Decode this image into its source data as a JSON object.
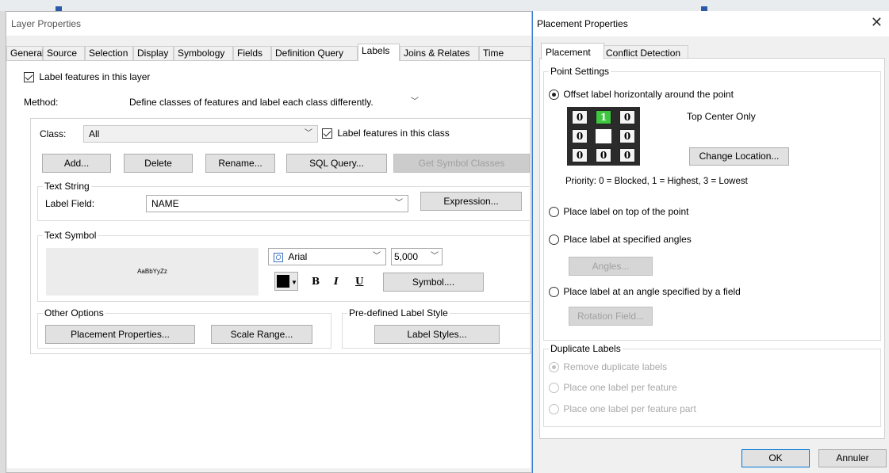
{
  "layer_props": {
    "title": "Layer Properties",
    "tabs": [
      "General",
      "Source",
      "Selection",
      "Display",
      "Symbology",
      "Fields",
      "Definition Query",
      "Labels",
      "Joins & Relates",
      "Time"
    ],
    "label_features_layer": "Label features in this layer",
    "method_label": "Method:",
    "method_value": "Define classes of features and label each class differently.",
    "class_label": "Class:",
    "class_value": "All",
    "label_features_class": "Label features in this class",
    "buttons": {
      "add": "Add...",
      "delete": "Delete",
      "rename": "Rename...",
      "sql_query": "SQL Query...",
      "get_symbol_classes": "Get Symbol Classes"
    },
    "text_string": {
      "legend": "Text String",
      "label_field_label": "Label Field:",
      "label_field_value": "NAME",
      "expression": "Expression..."
    },
    "text_symbol": {
      "legend": "Text Symbol",
      "preview": "AaBbYyZz",
      "font": "Arial",
      "size": "5,000",
      "bold": "B",
      "italic": "I",
      "underline": "U",
      "symbol": "Symbol....",
      "color": "#000000"
    },
    "other_options": {
      "legend": "Other Options",
      "placement": "Placement Properties...",
      "scale_range": "Scale Range..."
    },
    "predefined": {
      "legend": "Pre-defined Label Style",
      "label_styles": "Label Styles..."
    }
  },
  "placement_props": {
    "title": "Placement Properties",
    "close": "✕",
    "tabs": [
      "Placement",
      "Conflict Detection"
    ],
    "point_settings": "Point Settings",
    "offset_option": "Offset label horizontally around the point",
    "grid": [
      [
        "0",
        "1",
        "0"
      ],
      [
        "0",
        "",
        "0"
      ],
      [
        "0",
        "0",
        "0"
      ]
    ],
    "grid_note": "Top Center Only",
    "change_location": "Change Location...",
    "priority": "Priority:  0 = Blocked, 1 = Highest, 3 = Lowest",
    "on_top_option": "Place label on top of the point",
    "angles_option": "Place label at specified angles",
    "angles_button": "Angles...",
    "field_angle_option": "Place label at an angle specified by a field",
    "rotation_button": "Rotation Field...",
    "duplicate": {
      "legend": "Duplicate Labels",
      "remove": "Remove duplicate labels",
      "one_per_feature": "Place one label per feature",
      "one_per_part": "Place one label per feature part"
    },
    "ok": "OK",
    "cancel": "Annuler",
    "highlight_color": "#3ec63e"
  }
}
